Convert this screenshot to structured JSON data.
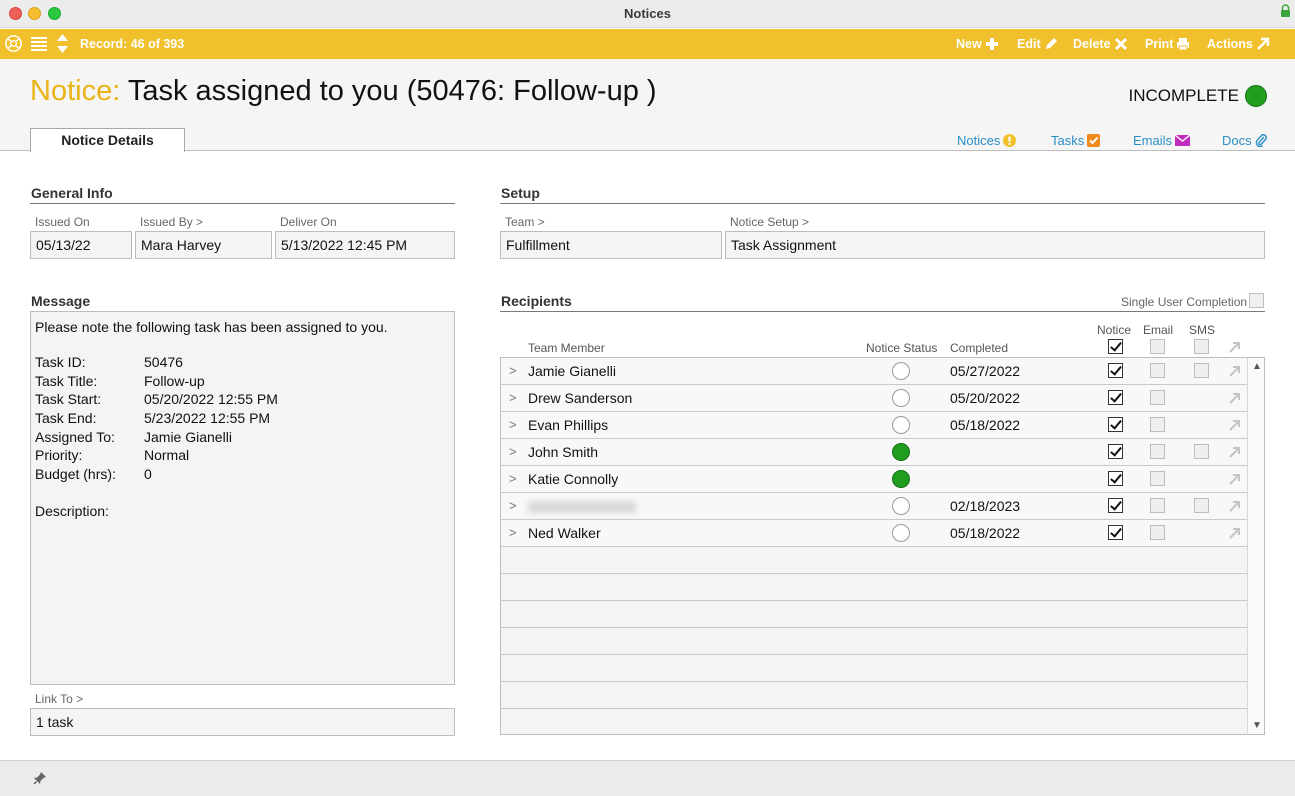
{
  "window": {
    "title": "Notices"
  },
  "toolbar": {
    "record": "Record: 46 of 393",
    "buttons": {
      "new": "New",
      "edit": "Edit",
      "delete": "Delete",
      "print": "Print",
      "actions": "Actions"
    }
  },
  "header": {
    "title_prefix": "Notice:",
    "title": "Task assigned to you (50476: Follow-up )",
    "status": "INCOMPLETE",
    "status_color": "#1f9d1f"
  },
  "tabs": {
    "active": "Notice Details"
  },
  "related_tabs": [
    {
      "label": "Notices",
      "icon": "exclamation-icon",
      "color": "#f0c12c"
    },
    {
      "label": "Tasks",
      "icon": "task-check-icon",
      "color": "#f08a1c"
    },
    {
      "label": "Emails",
      "icon": "envelope-icon",
      "color": "#c02cc0"
    },
    {
      "label": "Docs",
      "icon": "paperclip-icon",
      "color": "#2a8fc6"
    }
  ],
  "general_info": {
    "title": "General Info",
    "issued_on_label": "Issued On",
    "issued_on": "05/13/22",
    "issued_by_label": "Issued By >",
    "issued_by": "Mara Harvey",
    "deliver_on_label": "Deliver On",
    "deliver_on": "5/13/2022 12:45 PM"
  },
  "setup": {
    "title": "Setup",
    "team_label": "Team >",
    "team": "Fulfillment",
    "notice_setup_label": "Notice Setup >",
    "notice_setup": "Task Assignment"
  },
  "message": {
    "title": "Message",
    "intro": "Please note the following task has been assigned to you.",
    "fields": [
      {
        "k": "Task ID:",
        "v": "50476"
      },
      {
        "k": "Task Title:",
        "v": "Follow-up"
      },
      {
        "k": "Task Start:",
        "v": "05/20/2022  12:55 PM"
      },
      {
        "k": "Task End:",
        "v": "5/23/2022  12:55 PM"
      },
      {
        "k": "Assigned To:",
        "v": "Jamie Gianelli"
      },
      {
        "k": "Priority:",
        "v": "Normal"
      },
      {
        "k": "Budget (hrs):",
        "v": "0"
      }
    ],
    "description_label": "Description:",
    "link_to_label": "Link To >",
    "link_to": "1 task"
  },
  "recipients": {
    "title": "Recipients",
    "single_user_completion": "Single User Completion",
    "columns": {
      "team_member": "Team Member",
      "notice_status": "Notice Status",
      "completed": "Completed",
      "notice": "Notice",
      "email": "Email",
      "sms": "SMS"
    },
    "rows": [
      {
        "name": "Jamie Gianelli",
        "done": false,
        "completed": "05/27/2022",
        "notice": true,
        "email": false,
        "sms": true
      },
      {
        "name": "Drew Sanderson",
        "done": false,
        "completed": "05/20/2022",
        "notice": true,
        "email": false,
        "sms": false
      },
      {
        "name": "Evan Phillips",
        "done": false,
        "completed": "05/18/2022",
        "notice": true,
        "email": false,
        "sms": false
      },
      {
        "name": "John Smith",
        "done": true,
        "completed": "",
        "notice": true,
        "email": false,
        "sms": true
      },
      {
        "name": "Katie Connolly",
        "done": true,
        "completed": "",
        "notice": true,
        "email": false,
        "sms": false
      },
      {
        "name": "",
        "done": false,
        "completed": "02/18/2023",
        "notice": true,
        "email": false,
        "sms": true,
        "blurred": true
      },
      {
        "name": "Ned Walker",
        "done": false,
        "completed": "05/18/2022",
        "notice": true,
        "email": false,
        "sms": false
      }
    ]
  }
}
